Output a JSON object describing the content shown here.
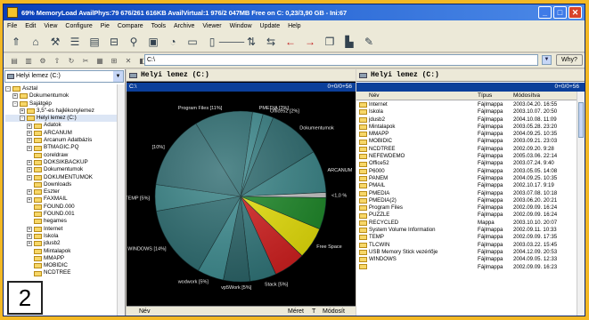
{
  "window": {
    "title": "69% MemoryLoad AvailPhys:79 676/261 616KB AvailVirtual:1 976/2 047MB Free on C: 0,23/3,90 GB - Ini:67"
  },
  "menu": [
    "File",
    "Edit",
    "View",
    "Configure",
    "Pie",
    "Compare",
    "Tools",
    "Archive",
    "Viewer",
    "Window",
    "Update",
    "Help"
  ],
  "toolbar": {
    "icons": [
      "up-icon",
      "home-icon",
      "tools-icon",
      "list-icon",
      "details-icon",
      "tree-icon",
      "binoculars-icon",
      "image-icon",
      "pie-icon",
      "panes-icon",
      "split-icon",
      "filter-icon",
      "sort-icon",
      "swap-icon",
      "back-icon",
      "forward-icon",
      "copy-icon",
      "chart-icon",
      "properties-icon"
    ],
    "path": "C:\\",
    "why_label": "Why?"
  },
  "tree": {
    "drive_label": "Helyi lemez (C:)",
    "items": [
      {
        "label": "Asztal",
        "indent": 0,
        "exp": "-"
      },
      {
        "label": "Dokumentumok",
        "indent": 1,
        "exp": "+"
      },
      {
        "label": "Sajátgép",
        "indent": 1,
        "exp": "-"
      },
      {
        "label": "3,5\"-es hajlékonylemez",
        "indent": 2,
        "exp": "+"
      },
      {
        "label": "Helyi lemez (C:)",
        "indent": 2,
        "exp": "-"
      },
      {
        "label": "Adatok",
        "indent": 3,
        "exp": "+"
      },
      {
        "label": "ARCANUM",
        "indent": 3,
        "exp": "+"
      },
      {
        "label": "Arcanum Adatbázis",
        "indent": 3,
        "exp": "+"
      },
      {
        "label": "BTMAGIC.PQ",
        "indent": 3,
        "exp": "+"
      },
      {
        "label": "coreldraw",
        "indent": 3,
        "exp": ""
      },
      {
        "label": "DOKSIKBACKUP",
        "indent": 3,
        "exp": "+"
      },
      {
        "label": "Dokumentumok",
        "indent": 3,
        "exp": "+"
      },
      {
        "label": "DOKUMENTUMOK",
        "indent": 3,
        "exp": "+"
      },
      {
        "label": "Downloads",
        "indent": 3,
        "exp": ""
      },
      {
        "label": "Eszter",
        "indent": 3,
        "exp": "+"
      },
      {
        "label": "FAXMAIL",
        "indent": 3,
        "exp": "+"
      },
      {
        "label": "FOUND.000",
        "indent": 3,
        "exp": ""
      },
      {
        "label": "FOUND.001",
        "indent": 3,
        "exp": ""
      },
      {
        "label": "hegames",
        "indent": 3,
        "exp": ""
      },
      {
        "label": "Internet",
        "indent": 3,
        "exp": "+"
      },
      {
        "label": "Iskola",
        "indent": 3,
        "exp": "+"
      },
      {
        "label": "jdusb2",
        "indent": 3,
        "exp": "+"
      },
      {
        "label": "Mintalapok",
        "indent": 3,
        "exp": ""
      },
      {
        "label": "MMAPP",
        "indent": 3,
        "exp": ""
      },
      {
        "label": "MOBIDIC",
        "indent": 3,
        "exp": ""
      },
      {
        "label": "NCDTREE",
        "indent": 3,
        "exp": ""
      }
    ]
  },
  "pie": {
    "header": "Helyi lemez (C:)",
    "status_left": "C:\\",
    "status_right": "0+0/0+56",
    "footer": {
      "name": "Név",
      "size": "Méret",
      "type": "T",
      "modified": "Módosít"
    },
    "slices": [
      {
        "label": "Program Files [11%]",
        "value": 11,
        "color": "#2f6f73"
      },
      {
        "label": "PMEDIA [2%]",
        "value": 2,
        "color": "#3e8b8f"
      },
      {
        "label": "Office52 [2%]",
        "value": 2,
        "color": "#357d81"
      },
      {
        "label": "Dokumentumok",
        "value": 10,
        "color": "#2c6a6e"
      },
      {
        "label": "ARCANUM",
        "value": 8,
        "color": "#3a8588"
      },
      {
        "label": "<1,0 %",
        "value": 1,
        "color": "#c8c8c8"
      },
      {
        "label": "",
        "value": 6,
        "color": "#1f8a2a"
      },
      {
        "label": "Free Space",
        "value": 6,
        "color": "#e9e20a"
      },
      {
        "label": "",
        "value": 6,
        "color": "#d42020"
      },
      {
        "label": "Stack [5%]",
        "value": 5,
        "color": "#31777b"
      },
      {
        "label": "vp5Work [5%]",
        "value": 5,
        "color": "#2b6569"
      },
      {
        "label": "wodwork [5%]",
        "value": 5,
        "color": "#3f8e92"
      },
      {
        "label": "WINDOWS [14%]",
        "value": 14,
        "color": "#2d6d71"
      },
      {
        "label": "TEMP [5%]",
        "value": 5,
        "color": "#3a8588"
      },
      {
        "label": "[10%]",
        "value": 14,
        "color": "#336f74"
      }
    ]
  },
  "files": {
    "header": "Helyi lemez (C:)",
    "status_right": "0+0/0+56",
    "columns": {
      "name": "Név",
      "type": "Típus",
      "date": "Módosítva"
    },
    "rows": [
      {
        "name": "Internet",
        "type": "Fájlmappa",
        "date": "2003.04.20. 16:55"
      },
      {
        "name": "Iskola",
        "type": "Fájlmappa",
        "date": "2003.10.07. 20:50"
      },
      {
        "name": "jdusb2",
        "type": "Fájlmappa",
        "date": "2004.10.08. 11:09"
      },
      {
        "name": "Mintalapok",
        "type": "Fájlmappa",
        "date": "2003.05.28. 23:20"
      },
      {
        "name": "MMAPP",
        "type": "Fájlmappa",
        "date": "2004.09.25. 10:35"
      },
      {
        "name": "MOBIDIC",
        "type": "Fájlmappa",
        "date": "2003.09.21. 23:03"
      },
      {
        "name": "NCDTREE",
        "type": "Fájlmappa",
        "date": "2002.09.20. 9:28"
      },
      {
        "name": "NEFEWDEMO",
        "type": "Fájlmappa",
        "date": "2005.03.06. 22:14"
      },
      {
        "name": "Office52",
        "type": "Fájlmappa",
        "date": "2003.07.24. 9:40"
      },
      {
        "name": "P6000",
        "type": "Fájlmappa",
        "date": "2003.05.05. 14:08"
      },
      {
        "name": "PANEM",
        "type": "Fájlmappa",
        "date": "2004.09.25. 10:35"
      },
      {
        "name": "PMAIL",
        "type": "Fájlmappa",
        "date": "2002.10.17. 9:19"
      },
      {
        "name": "PMEDIA",
        "type": "Fájlmappa",
        "date": "2003.07.08. 10:18"
      },
      {
        "name": "PMEDIA(2)",
        "type": "Fájlmappa",
        "date": "2003.06.20. 20:21"
      },
      {
        "name": "Program Files",
        "type": "Fájlmappa",
        "date": "2002.09.09. 16:24"
      },
      {
        "name": "PUZZLE",
        "type": "Fájlmappa",
        "date": "2002.09.09. 16:24"
      },
      {
        "name": "RECYCLED",
        "type": "Mappa",
        "date": "2003.10.10. 20:07"
      },
      {
        "name": "System Volume Information",
        "type": "Fájlmappa",
        "date": "2002.09.11. 10:33"
      },
      {
        "name": "TEMP",
        "type": "Fájlmappa",
        "date": "2002.09.09. 17:35"
      },
      {
        "name": "TLCWIN",
        "type": "Fájlmappa",
        "date": "2003.03.22. 15:45"
      },
      {
        "name": "USB Memory Stick vezérlője",
        "type": "Fájlmappa",
        "date": "2004.12.09. 20:53"
      },
      {
        "name": "WINDOWS",
        "type": "Fájlmappa",
        "date": "2004.09.05. 12:33"
      },
      {
        "name": "",
        "type": "Fájlmappa",
        "date": "2002.09.09. 16:23"
      }
    ]
  },
  "badge": "2"
}
